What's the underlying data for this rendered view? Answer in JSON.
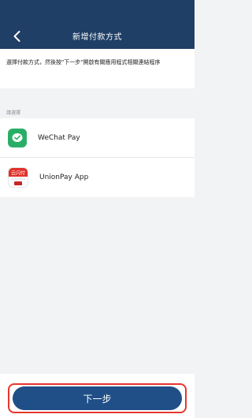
{
  "navbar": {
    "back_icon": "chevron-left-icon",
    "title": "新增付款方式"
  },
  "instruction": {
    "text": "選擇付款方式，然後按\"下一步\"開啟有關應用程式相關連結程序"
  },
  "section": {
    "label": "請選擇"
  },
  "payment_methods": [
    {
      "label": "WeChat Pay",
      "icon": "wechat-pay-icon"
    },
    {
      "label": "UnionPay App",
      "icon": "unionpay-icon"
    }
  ],
  "footer": {
    "next_label": "下一步"
  },
  "colors": {
    "navbar": "#1f3f66",
    "button": "#1f4f86",
    "highlight": "#e6362c",
    "wechat_green": "#2aae67",
    "unionpay_red": "#e0312a"
  }
}
